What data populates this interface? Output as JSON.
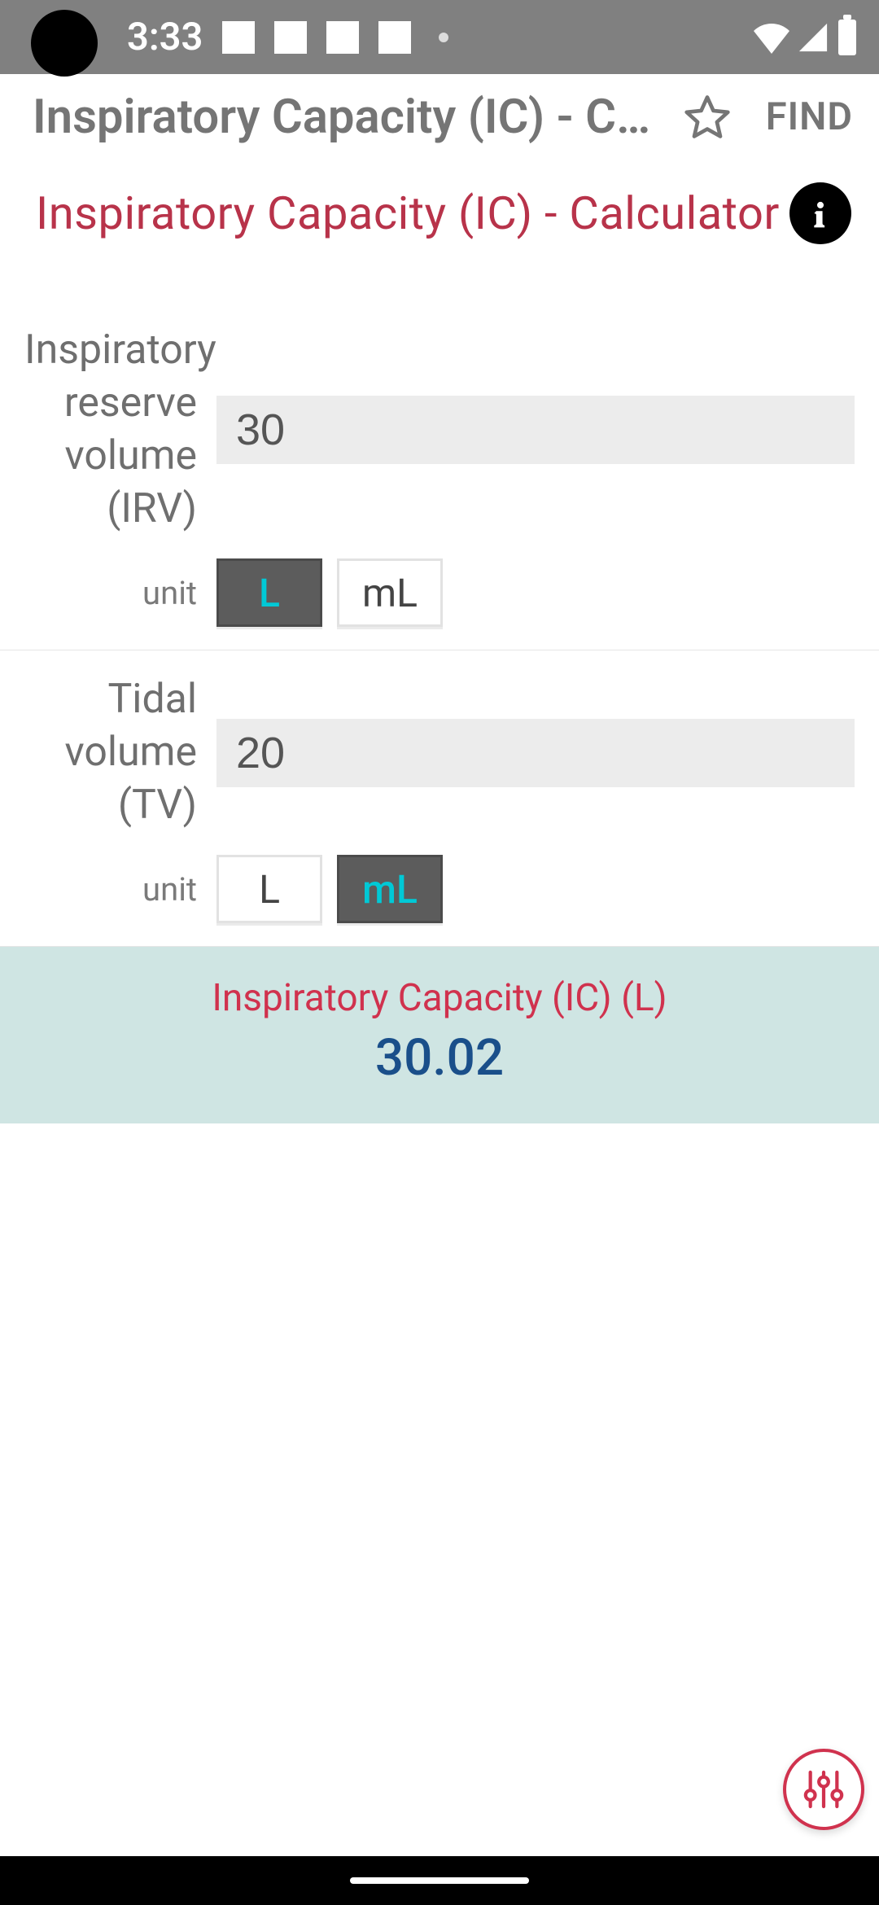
{
  "statusbar": {
    "time": "3:33"
  },
  "appbar": {
    "title": "Inspiratory Capacity (IC) - Ca…",
    "find": "FIND"
  },
  "title": "Inspiratory Capacity (IC) - Calculator",
  "fields": {
    "irv": {
      "label": "Inspiratory reserve volume (IRV)",
      "value": "30",
      "unit_label": "unit",
      "units": {
        "L": "L",
        "mL": "mL"
      },
      "selected": "L"
    },
    "tv": {
      "label": "Tidal volume (TV)",
      "value": "20",
      "unit_label": "unit",
      "units": {
        "L": "L",
        "mL": "mL"
      },
      "selected": "mL"
    }
  },
  "result": {
    "title": "Inspiratory Capacity (IC) (L)",
    "value": "30.02"
  }
}
